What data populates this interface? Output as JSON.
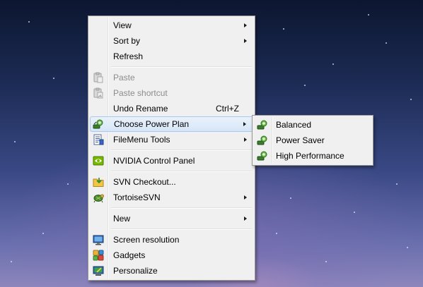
{
  "context_menu": {
    "items": [
      {
        "label": "View",
        "submenu": true
      },
      {
        "label": "Sort by",
        "submenu": true
      },
      {
        "label": "Refresh"
      },
      {
        "label": "Paste",
        "disabled": true,
        "icon": "paste-icon"
      },
      {
        "label": "Paste shortcut",
        "disabled": true,
        "icon": "paste-shortcut-icon"
      },
      {
        "label": "Undo Rename",
        "shortcut": "Ctrl+Z"
      },
      {
        "label": "Choose Power Plan",
        "submenu": true,
        "highlighted": true,
        "icon": "power-plan-icon"
      },
      {
        "label": "FileMenu Tools",
        "submenu": true,
        "icon": "filemenu-tools-icon"
      },
      {
        "label": "NVIDIA Control Panel",
        "icon": "nvidia-icon"
      },
      {
        "label": "SVN Checkout...",
        "icon": "svn-checkout-icon"
      },
      {
        "label": "TortoiseSVN",
        "submenu": true,
        "icon": "tortoisesvn-icon"
      },
      {
        "label": "New",
        "submenu": true
      },
      {
        "label": "Screen resolution",
        "icon": "monitor-icon"
      },
      {
        "label": "Gadgets",
        "icon": "gadgets-icon"
      },
      {
        "label": "Personalize",
        "icon": "personalize-icon"
      }
    ]
  },
  "power_plan_submenu": {
    "items": [
      {
        "label": "Balanced",
        "icon": "power-plan-icon"
      },
      {
        "label": "Power Saver",
        "icon": "power-plan-icon"
      },
      {
        "label": "High Performance",
        "icon": "power-plan-icon"
      }
    ]
  },
  "colors": {
    "menu_background": "#f0f0f0",
    "menu_border": "#979797",
    "hover_border": "#a8c8ee",
    "disabled_text": "#8c8c8c"
  }
}
